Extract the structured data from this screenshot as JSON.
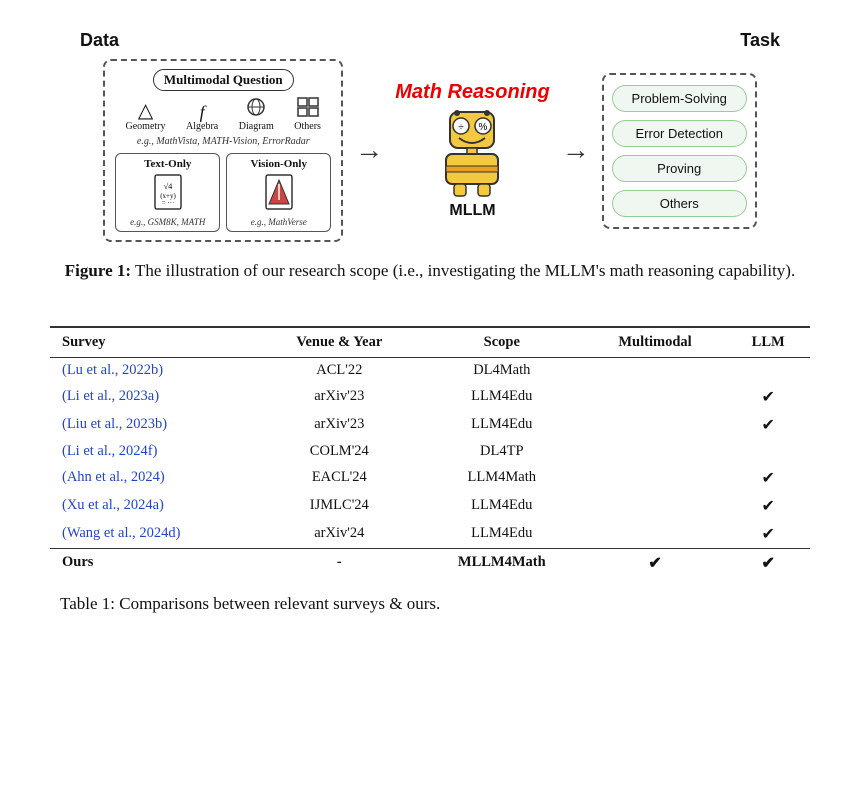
{
  "diagram": {
    "data_title": "Data",
    "task_title": "Task",
    "multimodal_question_label": "Multimodal Question",
    "icons": [
      {
        "label": "Geometry",
        "symbol": "△"
      },
      {
        "label": "Algebra",
        "symbol": "𝑓"
      },
      {
        "label": "Diagram",
        "symbol": "⊙"
      },
      {
        "label": "Others",
        "symbol": "⊞"
      }
    ],
    "examples_text": "e.g., MathVista, MATH-Vision, ErrorRadar",
    "text_only_label": "Text-Only",
    "text_only_icon": "√(x+y)\n=",
    "text_only_example": "e.g., GSM8K, MATH",
    "vision_only_label": "Vision-Only",
    "vision_only_icon": "△",
    "vision_only_example": "e.g., MathVerse",
    "math_reasoning_label": "Math Reasoning",
    "mllm_label": "MLLM",
    "tasks": [
      "Problem-Solving",
      "Error Detection",
      "Proving",
      "Others"
    ]
  },
  "figure_caption": {
    "label": "Figure 1:",
    "text": " The illustration of our research scope (i.e., investigating the MLLM's math reasoning capability)."
  },
  "table": {
    "columns": [
      "Survey",
      "Venue & Year",
      "Scope",
      "Multimodal",
      "LLM"
    ],
    "rows": [
      {
        "survey": "(Lu et al., 2022b)",
        "venue": "ACL'22",
        "scope": "DL4Math",
        "multimodal": "",
        "llm": ""
      },
      {
        "survey": "(Li et al., 2023a)",
        "venue": "arXiv'23",
        "scope": "LLM4Edu",
        "multimodal": "",
        "llm": "✔"
      },
      {
        "survey": "(Liu et al., 2023b)",
        "venue": "arXiv'23",
        "scope": "LLM4Edu",
        "multimodal": "",
        "llm": "✔"
      },
      {
        "survey": "(Li et al., 2024f)",
        "venue": "COLM'24",
        "scope": "DL4TP",
        "multimodal": "",
        "llm": ""
      },
      {
        "survey": "(Ahn et al., 2024)",
        "venue": "EACL'24",
        "scope": "LLM4Math",
        "multimodal": "",
        "llm": "✔"
      },
      {
        "survey": "(Xu et al., 2024a)",
        "venue": "IJMLC'24",
        "scope": "LLM4Edu",
        "multimodal": "",
        "llm": "✔"
      },
      {
        "survey": "(Wang et al., 2024d)",
        "venue": "arXiv'24",
        "scope": "LLM4Edu",
        "multimodal": "",
        "llm": "✔"
      }
    ],
    "ours_row": {
      "survey": "Ours",
      "venue": "-",
      "scope": "MLLM4Math",
      "multimodal": "✔",
      "llm": "✔"
    }
  },
  "table_caption": {
    "label": "Table 1:",
    "text": " Comparisons between relevant surveys & ours."
  }
}
